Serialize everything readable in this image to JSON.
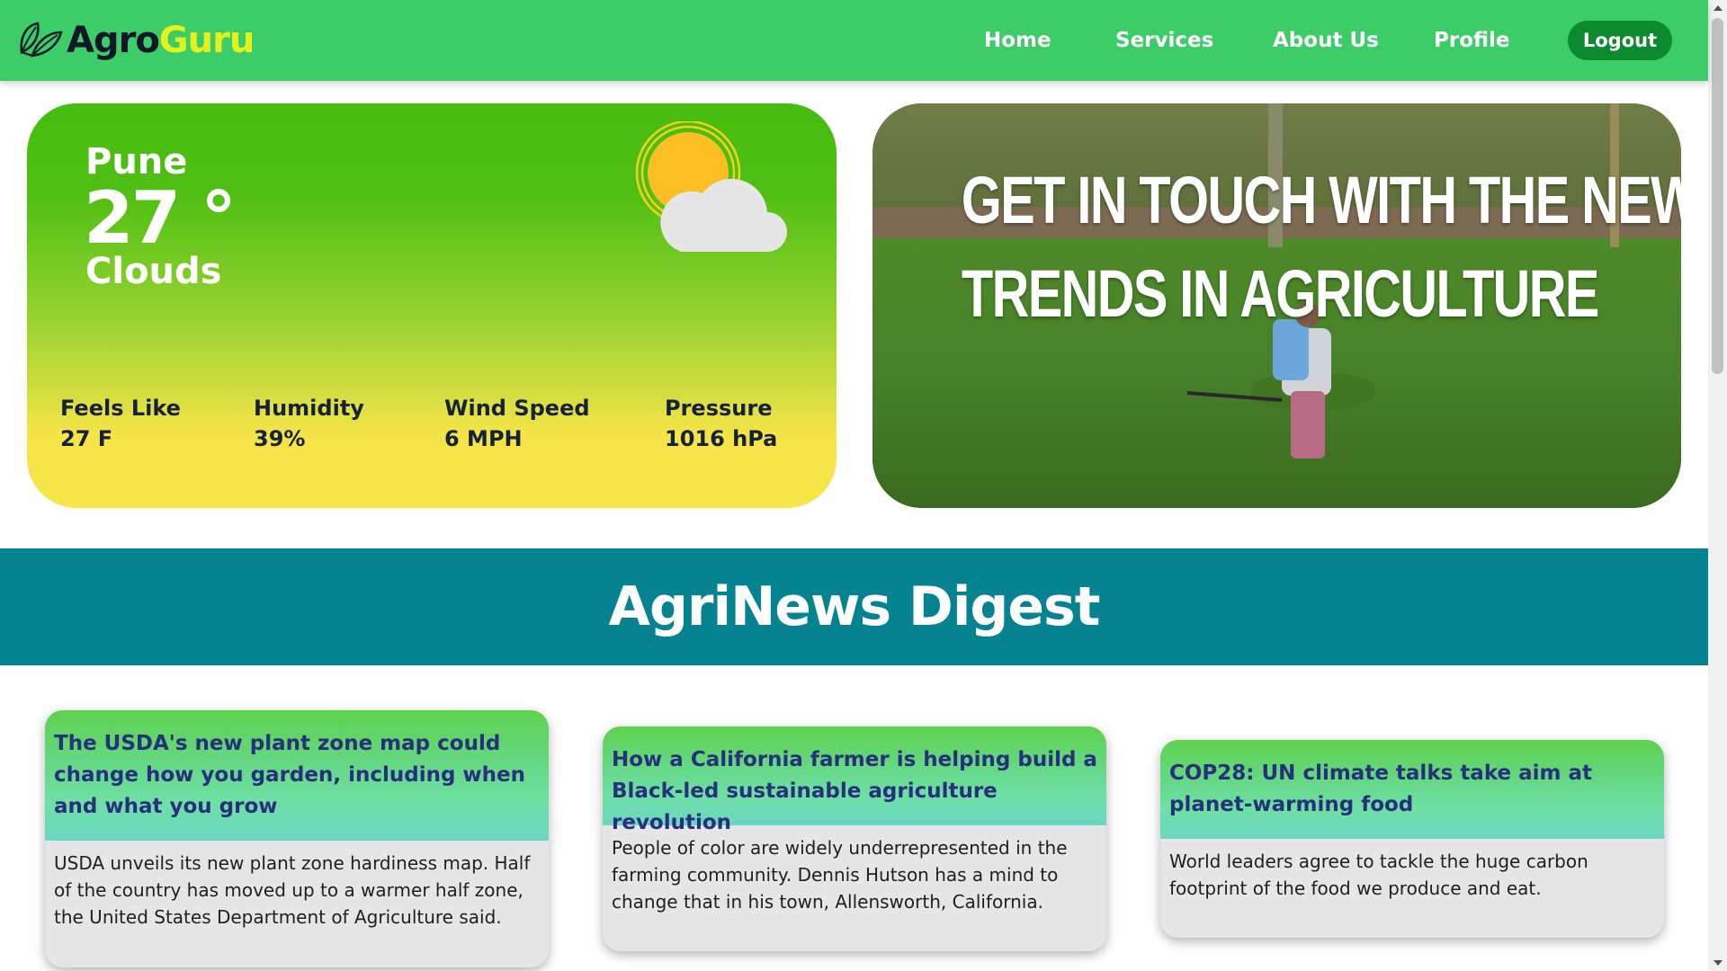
{
  "brand": {
    "part1": "Agro",
    "part2": "Guru"
  },
  "nav": {
    "home": "Home",
    "services": "Services",
    "about": "About Us",
    "profile": "Profile",
    "logout": "Logout"
  },
  "weather": {
    "city": "Pune",
    "temp": "27 °",
    "description": "Clouds",
    "icon": "sun-cloud-icon",
    "stats": [
      {
        "label": "Feels Like",
        "value": "27 F"
      },
      {
        "label": "Humidity",
        "value": "39%"
      },
      {
        "label": "Wind Speed",
        "value": "6 MPH"
      },
      {
        "label": "Pressure",
        "value": "1016 hPa"
      }
    ]
  },
  "hero": {
    "line1": "GET IN TOUCH WITH THE NEW",
    "line2": "TRENDS IN AGRICULTURE"
  },
  "news": {
    "heading": "AgriNews Digest",
    "articles": [
      {
        "title": "The USDA's new plant zone map could change how you garden, including when and what you grow",
        "summary": "USDA unveils its new plant zone hardiness map. Half of the country has moved up to a warmer half zone, the United States Department of Agriculture said."
      },
      {
        "title": "How a California farmer is helping build a Black-led sustainable agriculture revolution",
        "summary": "People of color are widely underrepresented in the farming community. Dennis Hutson has a mind to change that in his town, Allensworth, California."
      },
      {
        "title": "COP28: UN climate talks take aim at planet-warming food",
        "summary": "World leaders agree to tackle the huge carbon footprint of the food we produce and eat."
      }
    ]
  },
  "colors": {
    "navbar": "#3ccc68",
    "brand_accent": "#e4f21c",
    "logout": "#0b8a2e",
    "news_banner": "#068390",
    "card_title": "#27307a"
  }
}
